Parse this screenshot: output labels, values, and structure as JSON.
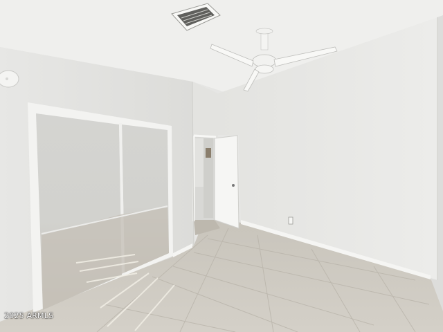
{
  "watermark": "2025 ARMLS",
  "colors": {
    "ceiling": "#eeeeec",
    "wall_left": "#e2e2df",
    "wall_back": "#dededb",
    "wall_right": "#e8e8e5",
    "floor": "#c9c5bc",
    "closet_frame": "#f4f4f2",
    "mirror": "#cfcfcb"
  },
  "icons": [
    "ceiling-fan-icon",
    "air-vent-icon",
    "smoke-detector-icon",
    "outlet-icon"
  ]
}
